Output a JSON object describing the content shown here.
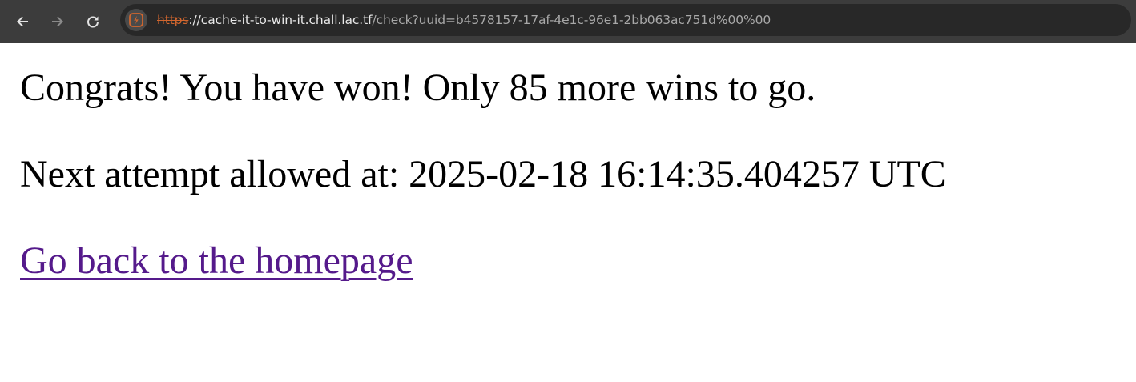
{
  "browser": {
    "url_scheme": "https",
    "url_host_part": "://cache-it-to-win-it.chall.lac.tf",
    "url_path_part": "/check?uuid=b4578157-17af-4e1c-96e1-2bb063ac751d%00%00",
    "icons": {
      "back": "arrow-left",
      "forward": "arrow-right",
      "reload": "reload",
      "site_info": "not-secure"
    },
    "colors": {
      "toolbar": "#3c3c3c",
      "omnibox": "#282828",
      "insecure_scheme": "#d2662e"
    }
  },
  "page": {
    "congrats_text": "Congrats! You have won! Only 85 more wins to go.",
    "next_attempt_text": "Next attempt allowed at: 2025-02-18 16:14:35.404257 UTC",
    "home_link_label": "Go back to the homepage",
    "colors": {
      "text": "#000000",
      "visited_link": "#551a8b"
    }
  }
}
